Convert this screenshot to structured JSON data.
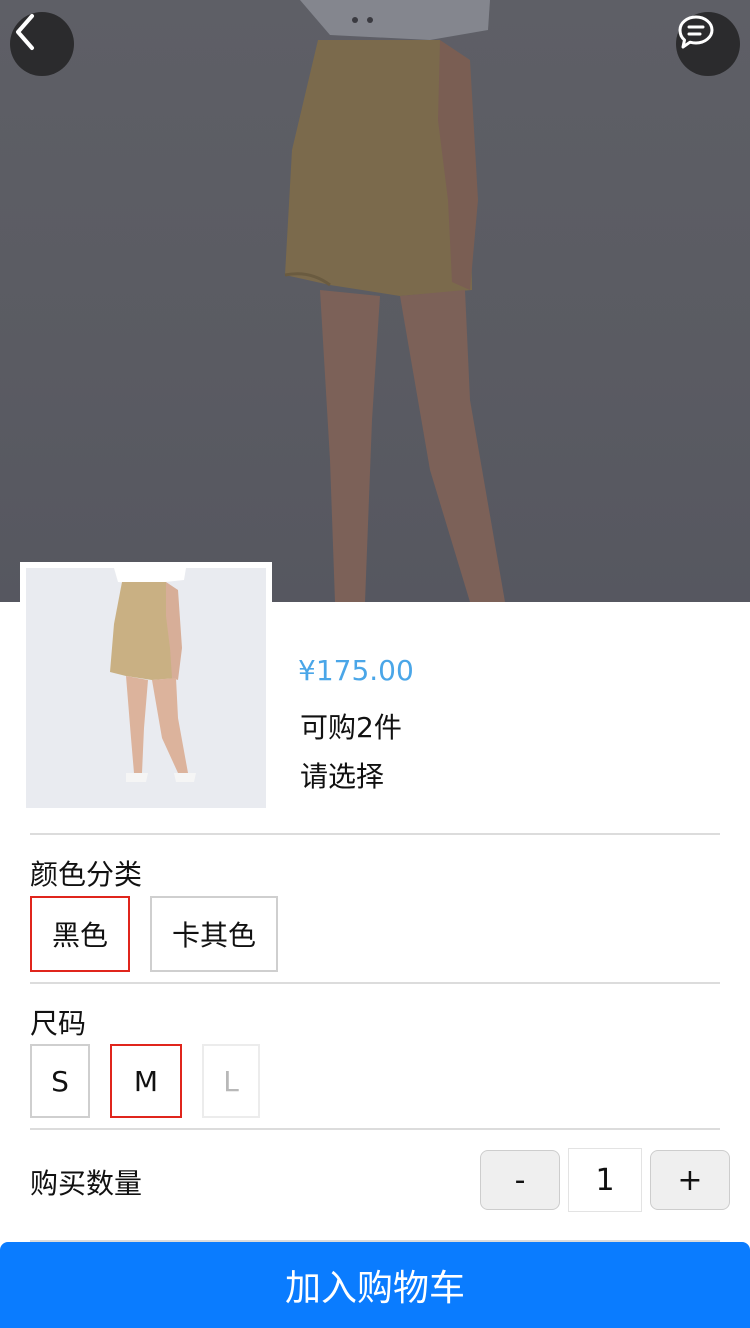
{
  "nav": {
    "back_icon": "chevron-left-icon",
    "chat_icon": "chat-bubble-icon"
  },
  "product": {
    "price": "¥175.00",
    "stock": "可购2件",
    "prompt": "请选择"
  },
  "color": {
    "label": "颜色分类",
    "options": [
      {
        "label": "黑色",
        "state": "selected"
      },
      {
        "label": "卡其色",
        "state": "normal"
      }
    ]
  },
  "size": {
    "label": "尺码",
    "options": [
      {
        "label": "S",
        "state": "normal"
      },
      {
        "label": "M",
        "state": "selected"
      },
      {
        "label": "L",
        "state": "disabled"
      }
    ]
  },
  "quantity": {
    "label": "购买数量",
    "minus": "-",
    "value": "1",
    "plus": "+"
  },
  "cart_button": "加入购物车",
  "colors": {
    "price": "#4aa6e8",
    "selected_border": "#e0251c",
    "primary": "#0a7cff"
  }
}
